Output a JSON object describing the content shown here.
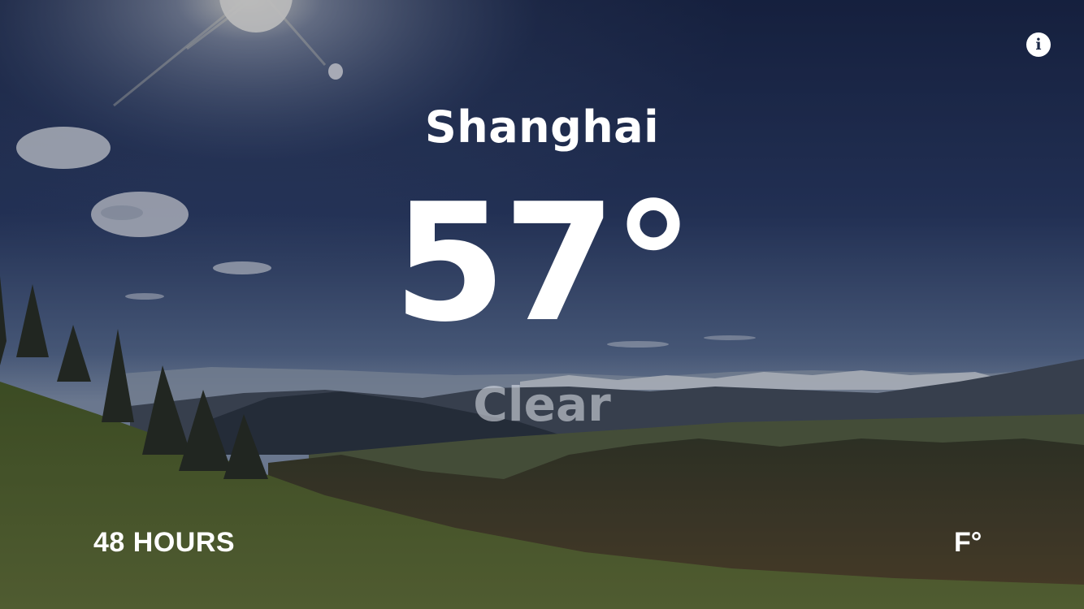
{
  "weather": {
    "city": "Shanghai",
    "temperature": "57°",
    "condition": "Clear"
  },
  "controls": {
    "forecast_label": "48 HOURS",
    "unit_label": "F°",
    "info_icon": "info-icon",
    "info_glyph": "i"
  },
  "colors": {
    "text": "#ffffff",
    "condition_text": "#e6e9f0",
    "sky_top": "#17213d",
    "sky_horizon": "#8fa3bd",
    "grass": "#5a6b2a"
  }
}
